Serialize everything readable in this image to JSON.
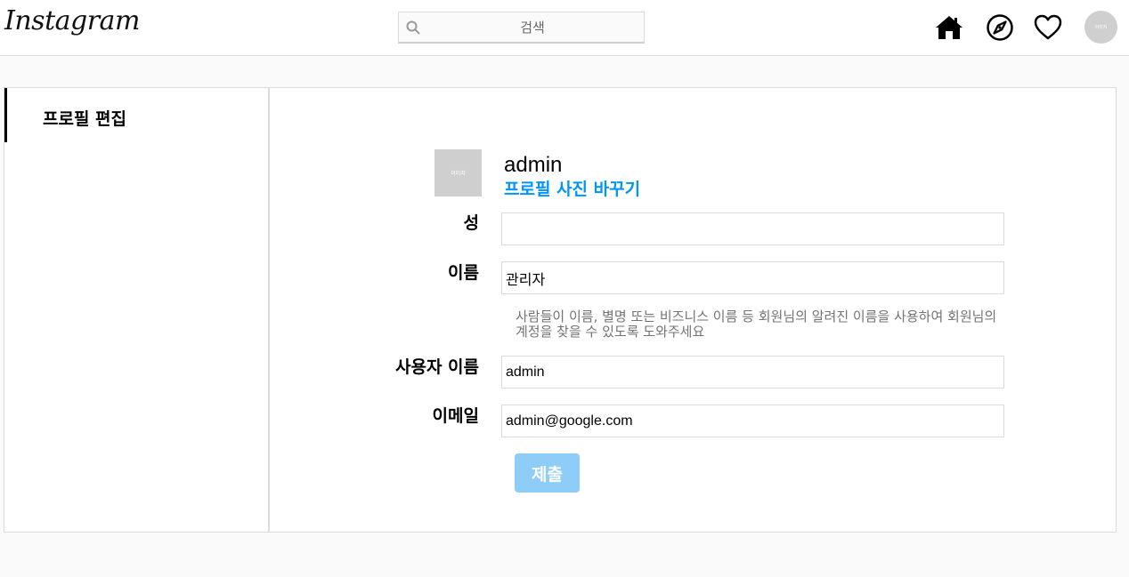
{
  "header": {
    "logo": "Instagram",
    "search_placeholder": "검색",
    "icons": [
      "home-icon",
      "explore-icon",
      "heart-icon"
    ],
    "avatar_text": "이미지"
  },
  "sidebar": {
    "items": [
      {
        "label": "프로필 편집",
        "active": true
      }
    ]
  },
  "profile": {
    "photo_text": "이미지",
    "username": "admin",
    "change_photo_label": "프로필 사진 바꾸기"
  },
  "form": {
    "last_name": {
      "label": "성",
      "value": ""
    },
    "first_name": {
      "label": "이름",
      "value": "관리자"
    },
    "name_hint": "사람들이 이름, 별명 또는 비즈니스 이름 등 회원님의 알려진 이름을 사용하여 회원님의 계정을 찾을 수 있도록 도와주세요",
    "user_name": {
      "label": "사용자 이름",
      "value": "admin"
    },
    "email": {
      "label": "이메일",
      "value": "admin@google.com"
    },
    "submit_label": "제출"
  },
  "colors": {
    "accent": "#0095f6",
    "submit_bg": "#8ecdf8",
    "border": "#dbdbdb",
    "page_bg": "#fafafa"
  }
}
